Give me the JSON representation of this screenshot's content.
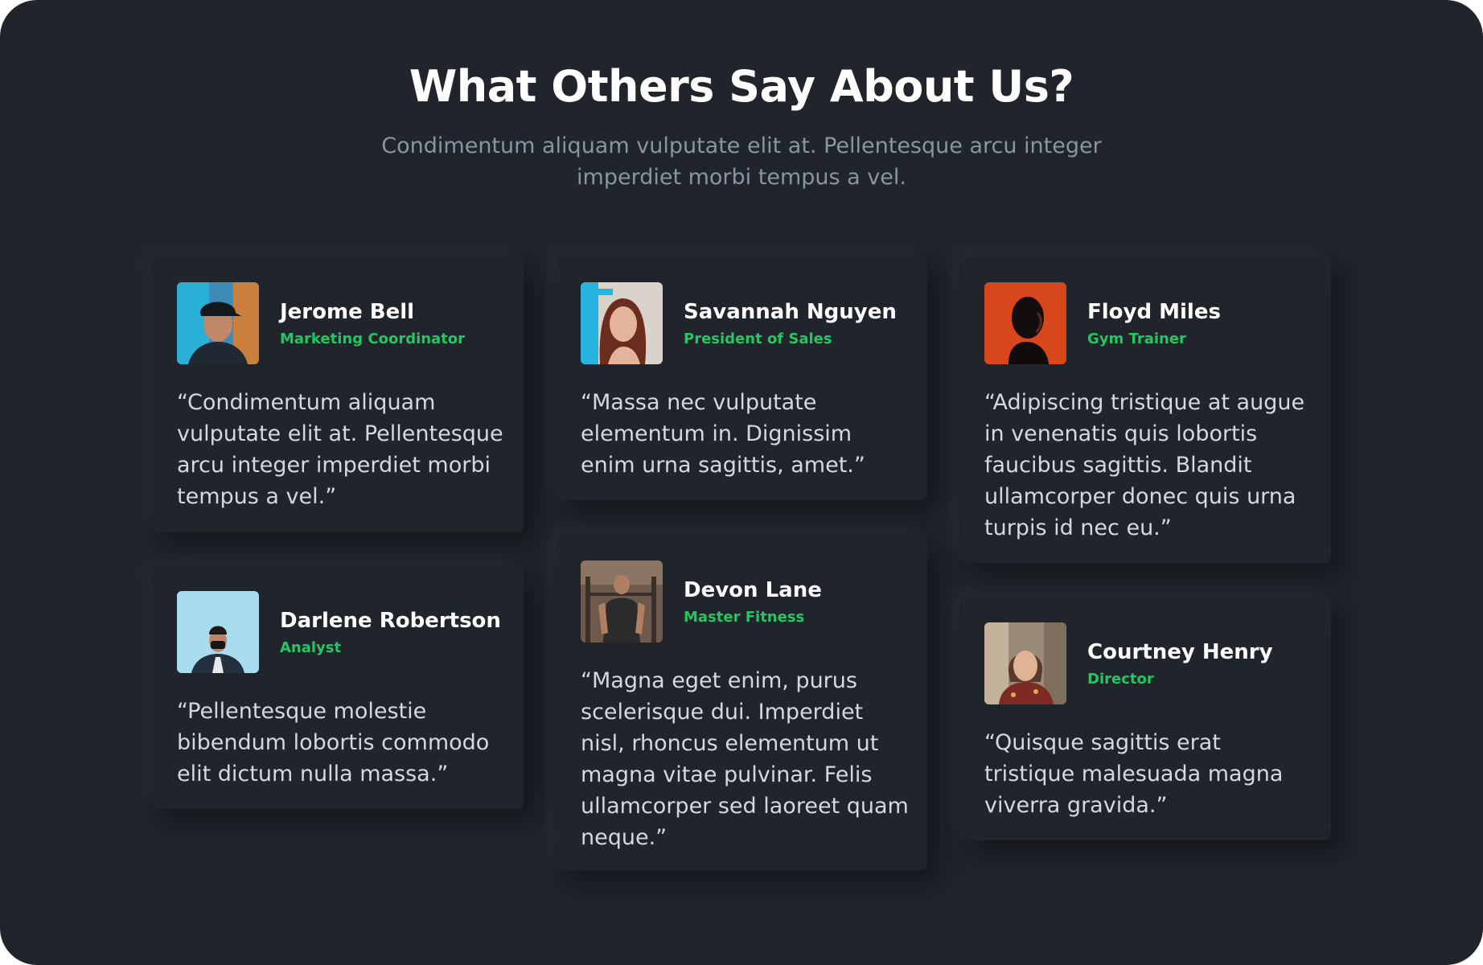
{
  "header": {
    "title": "What Others Say About Us?",
    "subtitle": "Condimentum aliquam vulputate elit at. Pellentesque arcu integer imperdiet morbi tempus a vel."
  },
  "theme": {
    "background": "#20242b",
    "card": "#20242b",
    "accent": "#25c662",
    "title_text": "#ffffff",
    "subtitle_text": "#8b94a3",
    "body_text": "#d5d9df"
  },
  "testimonials": [
    {
      "name": "Jerome Bell",
      "role": "Marketing Coordinator",
      "quote": "“Condimentum aliquam vulputate elit at. Pellentesque arcu integer imperdiet morbi tempus a vel.”",
      "avatar_icon": "avatar-man-cap-photo"
    },
    {
      "name": "Savannah Nguyen",
      "role": "President of Sales",
      "quote": "“Massa nec vulputate elementum in. Dignissim enim urna sagittis, amet.”",
      "avatar_icon": "avatar-woman-portrait-photo"
    },
    {
      "name": "Floyd Miles",
      "role": "Gym Trainer",
      "quote": "“Adipiscing tristique at augue in venenatis quis lobortis faucibus sagittis. Blandit ullamcorper donec quis urna turpis id nec eu.”",
      "avatar_icon": "avatar-man-orange-photo"
    },
    {
      "name": "Darlene Robertson",
      "role": "Analyst",
      "quote": "“Pellentesque molestie bibendum lobortis commodo elit dictum nulla massa.”",
      "avatar_icon": "avatar-person-mask-photo"
    },
    {
      "name": "Devon Lane",
      "role": "Master Fitness",
      "quote": "“Magna eget enim, purus scelerisque dui. Imperdiet nisl, rhoncus elementum ut magna vitae pulvinar. Felis ullamcorper sed laoreet quam neque.”",
      "avatar_icon": "avatar-man-gym-photo"
    },
    {
      "name": "Courtney Henry",
      "role": "Director",
      "quote": "“Quisque sagittis erat tristique malesuada magna viverra gravida.”",
      "avatar_icon": "avatar-woman-smiling-photo"
    }
  ]
}
